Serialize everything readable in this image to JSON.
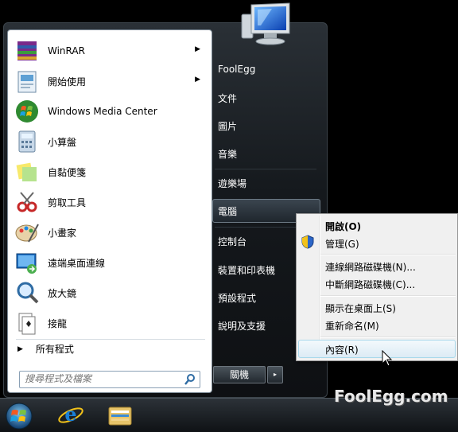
{
  "programs": [
    {
      "label": "WinRAR",
      "has_submenu": true,
      "icon": "winrar-icon"
    },
    {
      "label": "開始使用",
      "has_submenu": true,
      "icon": "getting-started-icon"
    },
    {
      "label": "Windows Media Center",
      "has_submenu": false,
      "icon": "media-center-icon"
    },
    {
      "label": "小算盤",
      "has_submenu": false,
      "icon": "calculator-icon"
    },
    {
      "label": "自黏便箋",
      "has_submenu": false,
      "icon": "sticky-notes-icon"
    },
    {
      "label": "剪取工具",
      "has_submenu": false,
      "icon": "snipping-tool-icon"
    },
    {
      "label": "小畫家",
      "has_submenu": false,
      "icon": "paint-icon"
    },
    {
      "label": "遠端桌面連線",
      "has_submenu": false,
      "icon": "remote-desktop-icon"
    },
    {
      "label": "放大鏡",
      "has_submenu": false,
      "icon": "magnifier-icon"
    },
    {
      "label": "接龍",
      "has_submenu": false,
      "icon": "solitaire-icon"
    }
  ],
  "all_programs": "所有程式",
  "search": {
    "placeholder": "搜尋程式及檔案"
  },
  "right_pane": {
    "user": "FoolEgg",
    "documents": "文件",
    "pictures": "圖片",
    "music": "音樂",
    "games": "遊樂場",
    "computer": "電腦",
    "control_panel": "控制台",
    "devices": "裝置和印表機",
    "default_programs": "預設程式",
    "help": "說明及支援"
  },
  "shutdown": {
    "label": "關機",
    "arrow": "▸"
  },
  "context_menu": {
    "open": "開啟(O)",
    "manage": "管理(G)",
    "map_drive": "連線網路磁碟機(N)...",
    "disconnect_drive": "中斷網路磁碟機(C)...",
    "show_desktop": "顯示在桌面上(S)",
    "rename": "重新命名(M)",
    "properties": "內容(R)"
  },
  "watermark": "FoolEgg.com",
  "colors": {
    "accent": "#3c7fb1",
    "menu_bg": "#15191d"
  }
}
